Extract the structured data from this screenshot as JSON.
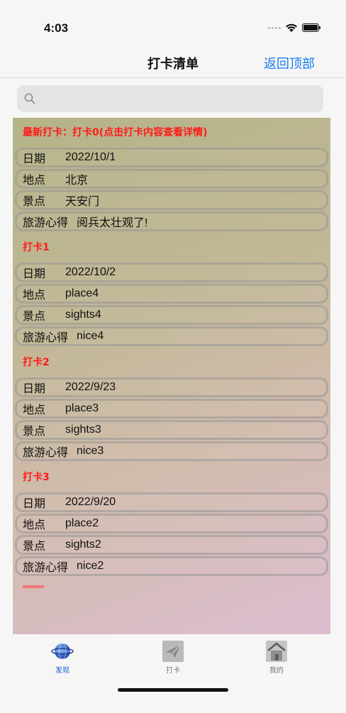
{
  "status": {
    "time": "4:03"
  },
  "nav": {
    "title": "打卡清单",
    "right_button": "返回顶部"
  },
  "search": {
    "placeholder": "",
    "value": ""
  },
  "sections": [
    {
      "header": "最新打卡：打卡0(点击打卡内容查看详情)",
      "rows": [
        {
          "label": "日期",
          "value": "2022/10/1"
        },
        {
          "label": "地点",
          "value": "北京"
        },
        {
          "label": "景点",
          "value": "天安门"
        },
        {
          "label": "旅游心得",
          "value": "阅兵太壮观了!"
        }
      ]
    },
    {
      "header": "打卡1",
      "rows": [
        {
          "label": "日期",
          "value": "2022/10/2"
        },
        {
          "label": "地点",
          "value": "place4"
        },
        {
          "label": "景点",
          "value": "sights4"
        },
        {
          "label": "旅游心得",
          "value": "nice4"
        }
      ]
    },
    {
      "header": "打卡2",
      "rows": [
        {
          "label": "日期",
          "value": "2022/9/23"
        },
        {
          "label": "地点",
          "value": "place3"
        },
        {
          "label": "景点",
          "value": "sights3"
        },
        {
          "label": "旅游心得",
          "value": "nice3"
        }
      ]
    },
    {
      "header": "打卡3",
      "rows": [
        {
          "label": "日期",
          "value": "2022/9/20"
        },
        {
          "label": "地点",
          "value": "place2"
        },
        {
          "label": "景点",
          "value": "sights2"
        },
        {
          "label": "旅游心得",
          "value": "nice2"
        }
      ]
    }
  ],
  "tabs": [
    {
      "label": "发现",
      "icon": "globe-icon",
      "active": true
    },
    {
      "label": "打卡",
      "icon": "paper-plane-icon",
      "active": false
    },
    {
      "label": "我的",
      "icon": "house-icon",
      "active": false
    }
  ],
  "colors": {
    "accent": "#1a7cf3",
    "header_red": "#ff1a1a"
  }
}
